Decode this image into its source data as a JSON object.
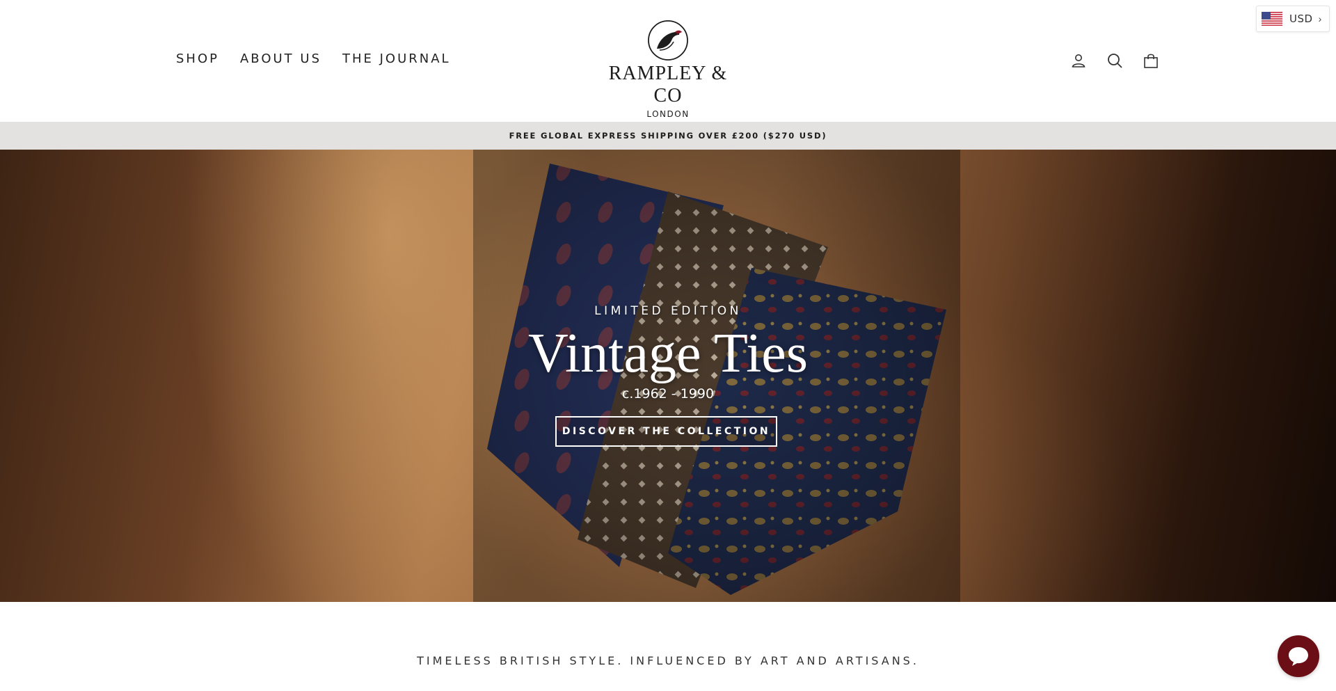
{
  "nav": {
    "items": [
      {
        "label": "SHOP"
      },
      {
        "label": "ABOUT US"
      },
      {
        "label": "THE JOURNAL"
      }
    ]
  },
  "logo": {
    "name": "RAMPLEY & CO",
    "sub": "LONDON",
    "icon": "bird-emblem-icon"
  },
  "header_icons": [
    "user-icon",
    "search-icon",
    "cart-icon"
  ],
  "currency": {
    "code": "USD",
    "flag": "us-flag-icon"
  },
  "announcement": {
    "text": "FREE GLOBAL EXPRESS SHIPPING OVER £200 ($270 USD)"
  },
  "hero": {
    "eyebrow": "LIMITED EDITION",
    "title": "Vintage Ties",
    "subtitle": "c.1962 - 1990",
    "cta": "DISCOVER THE COLLECTION"
  },
  "tagline": "TIMELESS BRITISH STYLE. INFLUENCED BY ART AND ARTISANS.",
  "chat": {
    "icon": "chat-bubble-icon"
  },
  "colors": {
    "brand": "#6b0e16",
    "announcement_bg": "#e4e2e0",
    "text": "#1c1c1c"
  }
}
